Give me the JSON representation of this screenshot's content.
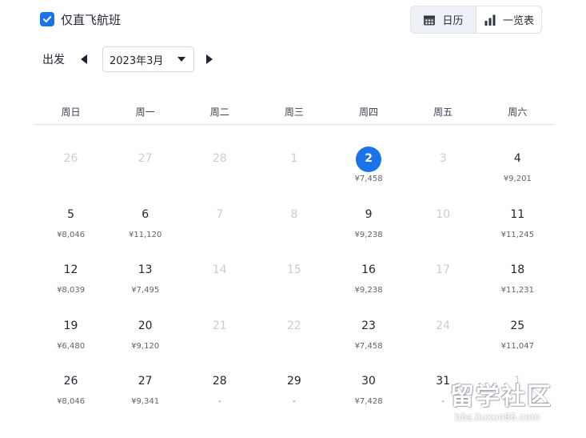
{
  "filters": {
    "direct_only_label": "仅直飞航班",
    "direct_only_checked": true
  },
  "view_toggle": {
    "calendar_label": "日历",
    "calendar_icon": "calendar-icon",
    "list_label": "一览表",
    "list_icon": "bar-chart-icon",
    "active": "calendar"
  },
  "depart": {
    "label": "出发",
    "month_value": "2023年3月"
  },
  "weekdays": [
    "周日",
    "周一",
    "周二",
    "周三",
    "周四",
    "周五",
    "周六"
  ],
  "weeks": [
    [
      {
        "day": "26",
        "price": "",
        "disabled": true
      },
      {
        "day": "27",
        "price": "",
        "disabled": true
      },
      {
        "day": "28",
        "price": "",
        "disabled": true
      },
      {
        "day": "1",
        "price": "",
        "disabled": true
      },
      {
        "day": "2",
        "price": "¥7,458",
        "disabled": false,
        "selected": true
      },
      {
        "day": "3",
        "price": "",
        "disabled": true
      },
      {
        "day": "4",
        "price": "¥9,201",
        "disabled": false
      }
    ],
    [
      {
        "day": "5",
        "price": "¥8,046",
        "disabled": false
      },
      {
        "day": "6",
        "price": "¥11,120",
        "disabled": false
      },
      {
        "day": "7",
        "price": "",
        "disabled": true
      },
      {
        "day": "8",
        "price": "",
        "disabled": true
      },
      {
        "day": "9",
        "price": "¥9,238",
        "disabled": false
      },
      {
        "day": "10",
        "price": "",
        "disabled": true
      },
      {
        "day": "11",
        "price": "¥11,245",
        "disabled": false
      }
    ],
    [
      {
        "day": "12",
        "price": "¥8,039",
        "disabled": false
      },
      {
        "day": "13",
        "price": "¥7,495",
        "disabled": false
      },
      {
        "day": "14",
        "price": "",
        "disabled": true
      },
      {
        "day": "15",
        "price": "",
        "disabled": true
      },
      {
        "day": "16",
        "price": "¥9,238",
        "disabled": false
      },
      {
        "day": "17",
        "price": "",
        "disabled": true
      },
      {
        "day": "18",
        "price": "¥11,231",
        "disabled": false
      }
    ],
    [
      {
        "day": "19",
        "price": "¥6,480",
        "disabled": false
      },
      {
        "day": "20",
        "price": "¥9,120",
        "disabled": false
      },
      {
        "day": "21",
        "price": "",
        "disabled": true
      },
      {
        "day": "22",
        "price": "",
        "disabled": true
      },
      {
        "day": "23",
        "price": "¥7,458",
        "disabled": false
      },
      {
        "day": "24",
        "price": "",
        "disabled": true
      },
      {
        "day": "25",
        "price": "¥11,047",
        "disabled": false
      }
    ],
    [
      {
        "day": "26",
        "price": "¥8,046",
        "disabled": false
      },
      {
        "day": "27",
        "price": "¥9,341",
        "disabled": false
      },
      {
        "day": "28",
        "price": "-",
        "disabled": false
      },
      {
        "day": "29",
        "price": "-",
        "disabled": false
      },
      {
        "day": "30",
        "price": "¥7,428",
        "disabled": false
      },
      {
        "day": "31",
        "price": "-",
        "disabled": false
      },
      {
        "day": "1",
        "price": "",
        "disabled": true
      }
    ]
  ],
  "colors": {
    "accent": "#1a73e8",
    "disabled_text": "#c9ccd3",
    "price_text": "#5d6370"
  },
  "watermark": {
    "title": "留学社区",
    "url": "bbs.liuxue86.com"
  }
}
